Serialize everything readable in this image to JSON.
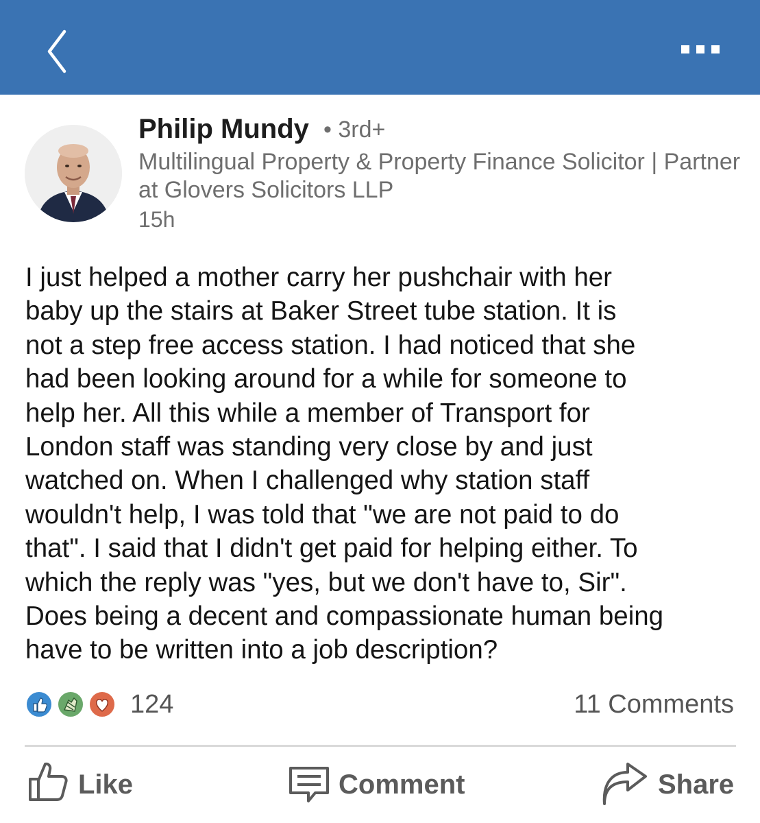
{
  "header": {
    "back_icon": "chevron-left-icon",
    "more_icon": "more-dots-icon",
    "bar_color": "#3a73b3"
  },
  "author": {
    "name": "Philip Mundy",
    "degree": "• 3rd+",
    "headline": "Multilingual Property & Property Finance Solicitor | Partner at Glovers Solicitors LLP",
    "time": "15h"
  },
  "post": {
    "body": "I just helped a mother carry her pushchair with her\nbaby up the stairs at Baker Street tube station. It is\nnot a step free access station. I had noticed that she\nhad been looking around for a while for someone to\nhelp her. All this while a member of Transport for\nLondon staff was standing very close by and just\nwatched on. When I challenged why station staff\nwouldn't help, I was told that \"we are not paid to do\nthat\". I said that I didn't get paid for helping either. To\nwhich the reply was \"yes, but we don't have to, Sir\".\nDoes being a decent and compassionate human being\nhave to be written into a job description?"
  },
  "social": {
    "reaction_icons": [
      "like-icon",
      "celebrate-icon",
      "love-icon"
    ],
    "reaction_count": "124",
    "comments": "11 Comments"
  },
  "actions": {
    "like": "Like",
    "comment": "Comment",
    "share": "Share"
  }
}
